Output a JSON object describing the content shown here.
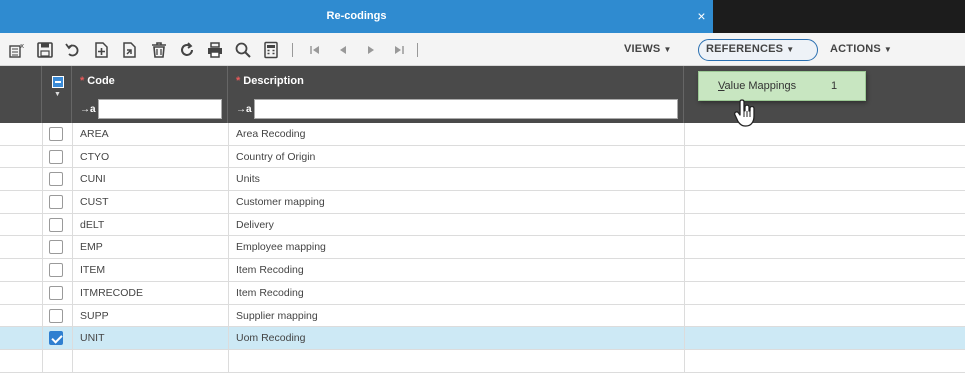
{
  "window": {
    "title": "Re-codings",
    "close_glyph": "×"
  },
  "toolbar": {
    "icons": [
      "export-excel-icon",
      "save-icon",
      "undo-icon",
      "add-icon",
      "copy-icon",
      "delete-icon",
      "refresh-icon",
      "print-icon",
      "search-icon",
      "calculator-icon",
      "first-page-icon",
      "previous-page-icon",
      "next-page-icon",
      "last-page-icon"
    ],
    "views_label": "VIEWS",
    "references_label": "REFERENCES",
    "actions_label": "ACTIONS"
  },
  "table": {
    "columns": [
      {
        "key": "code",
        "label": "Code",
        "required": true,
        "filter_prefix": "→a",
        "filter_value": ""
      },
      {
        "key": "description",
        "label": "Description",
        "required": true,
        "filter_prefix": "→a",
        "filter_value": ""
      }
    ],
    "rows": [
      {
        "code": "AREA",
        "description": "Area Recoding",
        "checked": false
      },
      {
        "code": "CTYO",
        "description": "Country of Origin",
        "checked": false
      },
      {
        "code": "CUNI",
        "description": "Units",
        "checked": false
      },
      {
        "code": "CUST",
        "description": "Customer mapping",
        "checked": false
      },
      {
        "code": "dELT",
        "description": "Delivery",
        "checked": false
      },
      {
        "code": "EMP",
        "description": "Employee mapping",
        "checked": false
      },
      {
        "code": "ITEM",
        "description": "Item Recoding",
        "checked": false
      },
      {
        "code": "ITMRECODE",
        "description": "Item Recoding",
        "checked": false
      },
      {
        "code": "SUPP",
        "description": "Supplier mapping",
        "checked": false
      },
      {
        "code": "UNIT",
        "description": "Uom Recoding",
        "checked": true
      },
      {
        "code": "",
        "description": "",
        "checked": null
      }
    ]
  },
  "references_menu": {
    "items": [
      {
        "label_first": "V",
        "label_rest": "alue Mappings",
        "count": "1"
      }
    ]
  },
  "colors": {
    "title_bar": "#2f8bd0",
    "header": "#4a4a4a",
    "selected_row": "#cde9f5",
    "menu_bg": "#c8e6c1",
    "accent": "#2f7fd0"
  }
}
